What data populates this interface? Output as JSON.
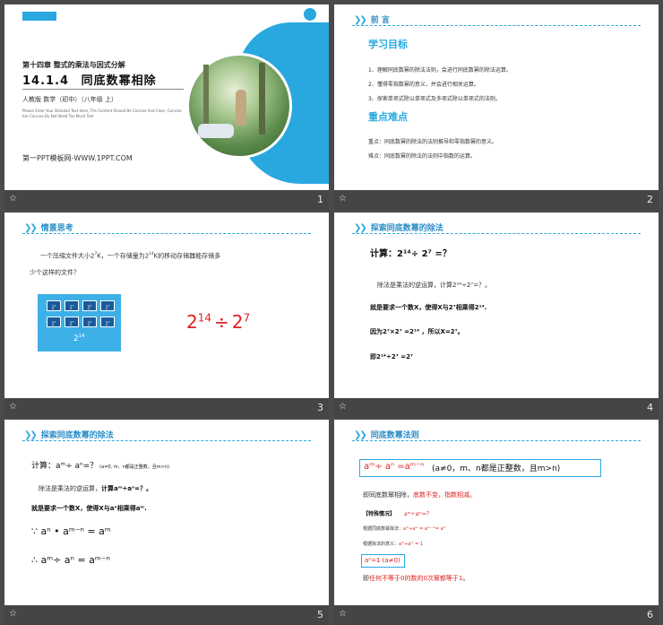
{
  "slides": [
    {
      "num": "1",
      "chapter": "第十四章 整式的乘法与因式分解",
      "title_num": "14.1.4",
      "title": "同底数幂相除",
      "edition": "人教版 数学（初中）（八年级 上）",
      "blurb": "Please Enter Your Detailed Text Here, The Content Should Be Concise And Clear, Concise Are Concise Do Not Need Too Much Text",
      "site": "第一PPT模板网-WWW.1PPT.COM"
    },
    {
      "num": "2",
      "header": "前 言",
      "goal_title": "学习目标",
      "goals": [
        "1、理解同底数幂的除法法则，会进行同底数幂的除法运算。",
        "2、懂得零指数幂的意义，并会进行相关运算。",
        "3、探索单项式除以单项式及多项式除以单项式的法则。"
      ],
      "key_title": "重点难点",
      "key_points": [
        "重点：同底数幂的除法的法则推导和零指数幂的意义。",
        "难点：同底数幂的除法的法则中指数的运算。"
      ]
    },
    {
      "num": "3",
      "header": "情景思考",
      "problem_a": "一个压缩文件大小2",
      "problem_a2": "K，一个存储量为2",
      "problem_a3": "K的移动存储器能存储多",
      "problem_b": "少个这样的文件？",
      "exp_small": "7",
      "exp_big": "14",
      "box_base": "2",
      "box_total_base": "2",
      "expr_base1": "2",
      "expr_op": "÷",
      "expr_base2": "2"
    },
    {
      "num": "4",
      "header": "探索同底数幂的除法",
      "calc": "计算：",
      "calc_expr": "2¹⁴÷ 2⁷ =？",
      "l1": "除法是乘法的逆运算，计算2¹⁴÷2⁷=？。",
      "l2": "就是要求一个数X，使得X与2⁷相乘得2¹⁴.",
      "l3": "因为2⁷×2⁷ =2¹⁴ ，所以X=2⁷。",
      "l4": "即2¹⁴÷2⁷ =2⁷"
    },
    {
      "num": "5",
      "header": "探索同底数幂的除法",
      "calc": "计算：aᵐ÷ aⁿ=？",
      "calc_note": "(a≠0, m、n都是正整数，且m>n)",
      "l1a": "除法是乘法的逆运算，",
      "l1b": "计算aᵐ÷aⁿ=？。",
      "l2": "就是要求一个数X，使得X与aⁿ相乘得aᵐ.",
      "f1": "∵ aⁿ • aᵐ⁻ⁿ = aᵐ",
      "f2": "∴ aᵐ÷ aⁿ = aᵐ⁻ⁿ"
    },
    {
      "num": "6",
      "header": "同底数幂法则",
      "rule_red": "aᵐ÷ aⁿ =aᵐ⁻ⁿ",
      "rule_black": "(a≠0，m、n都是正整数，且m>n)",
      "line1a": "即同底数幂相除，",
      "line1b": "底数不变，指数相减。",
      "special_a": "【特殊情况】",
      "special_b": "aᵐ÷aᵐ=？",
      "spec1a": "根据同底数幂除法：",
      "spec1b": "aᵐ÷aᵐ = aᵐ⁻ᵐ= a⁰",
      "spec2a": "根据除法的意义：",
      "spec2b": "aᵐ÷aᵐ = 1",
      "box": "a⁰=1 (a≠0)",
      "last_a": "即",
      "last_b": "任何不等于0的数的0次幂都等于1",
      "last_c": "。"
    }
  ],
  "colors": {
    "accent": "#29a8e0",
    "header_blue": "#2a8ec8",
    "rule_red": "#e02020",
    "footer": "#454545"
  }
}
